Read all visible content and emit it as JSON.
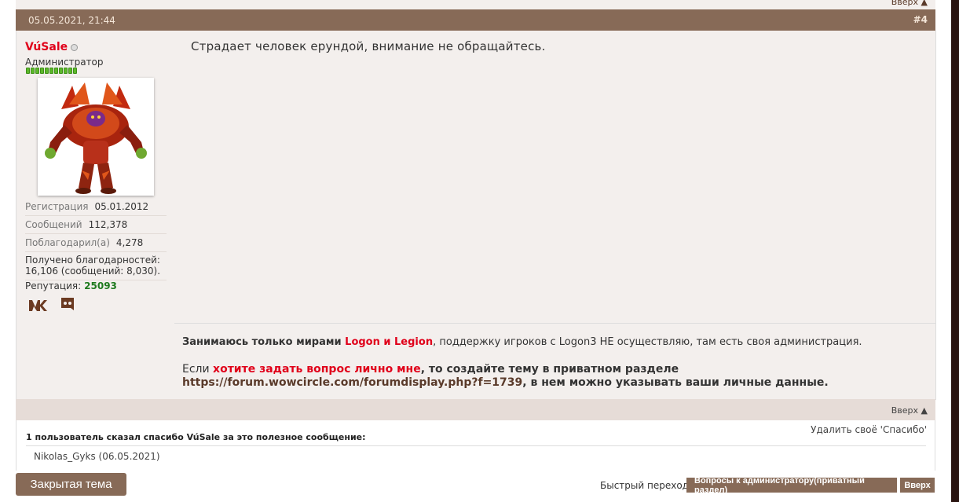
{
  "top_link_label": "Вверх ▲",
  "post": {
    "date": "05.05.2021, 21:44",
    "number": "#4",
    "message": "Страдает человек ерундой, внимание не обращайтесь."
  },
  "user": {
    "name": "VúSale",
    "title": "Администратор",
    "reputation_pips": 11,
    "avatar_icon": "warcraft-character-avatar",
    "stats": {
      "reg_label": "Регистрация",
      "reg_value": "05.01.2012",
      "posts_label": "Сообщений",
      "posts_value": "112,378",
      "thanked_label": "Поблагодарил(а)",
      "thanked_value": "4,278",
      "received_line1": "Получено благодарностей:",
      "received_line2": "16,106 (сообщений: 8,030)."
    },
    "reputation_label": "Репутация:",
    "reputation_value": "25093",
    "social": {
      "vk_icon": "vk-icon",
      "discord_icon": "discord-icon"
    }
  },
  "signature": {
    "l1_a": "Занимаюсь только мирами ",
    "l1_b": "Logon и Legion",
    "l1_c": ", поддержку игроков с Logon3 НЕ осуществляю, там есть своя администрация.",
    "l2_a": "Если ",
    "l2_b": "хотите задать вопрос лично мне",
    "l2_c": ", то создайте тему в приватном разделе ",
    "l2_link": "https://forum.wowcircle.com/forumdisplay.php?f=1739",
    "l2_d": ", в нем можно указывать ваши личные данные."
  },
  "thanks": {
    "remove_label": "Удалить своё 'Спасибо'",
    "title": "1 пользователь сказал спасибо VúSale за это полезное сообщение:",
    "users": "Nikolas_Gyks (06.05.2021)"
  },
  "footer": {
    "closed_label": "Закрытая тема",
    "quick_nav_label": "Быстрый переход",
    "quick_nav_selected": "Вопросы к администратору(приватный раздел)",
    "go_label": "Вверх"
  },
  "colors": {
    "accent": "#876a57",
    "panel": "#f3efed",
    "username": "#e0001a",
    "reputation": "#1e7a1e"
  }
}
